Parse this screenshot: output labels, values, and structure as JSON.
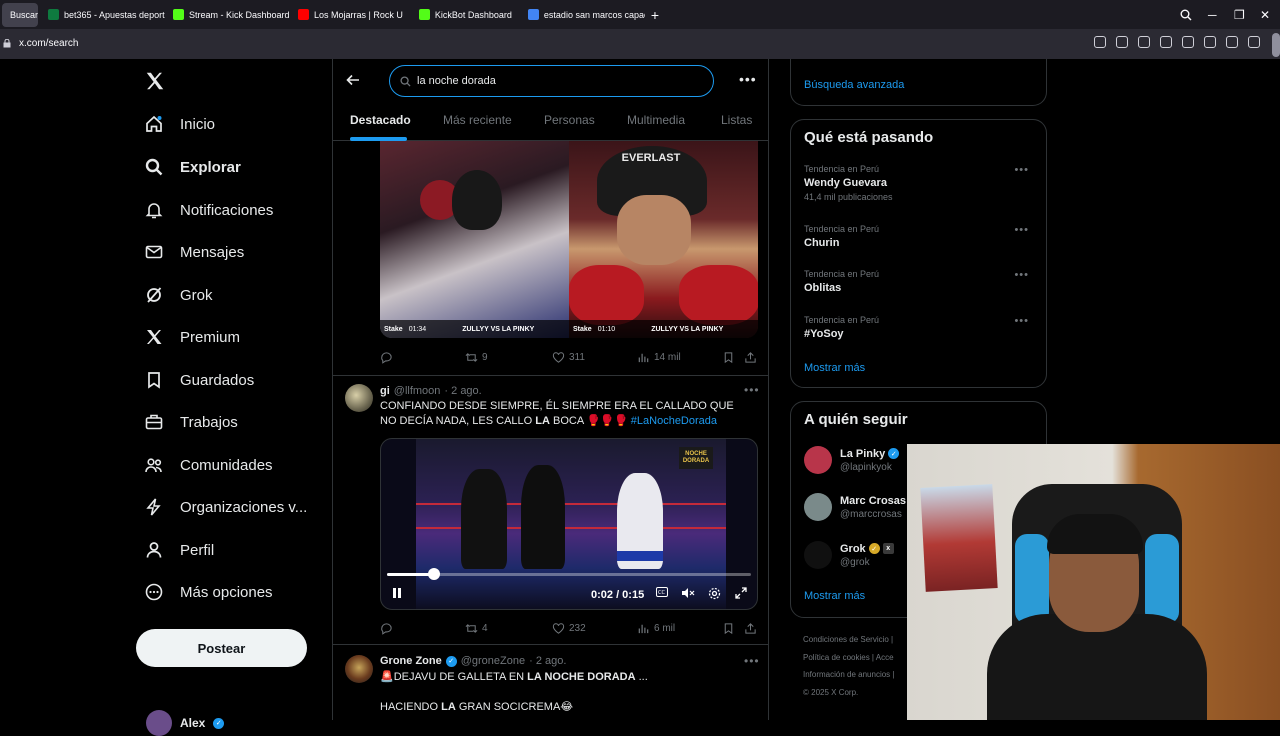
{
  "browser": {
    "tabs": [
      {
        "label": "Buscar",
        "active": true,
        "color": "#1d9bf0"
      },
      {
        "label": "bet365 - Apuestas deport",
        "active": false,
        "color": "#0e7a3f"
      },
      {
        "label": "Stream - Kick Dashboard",
        "active": false,
        "color": "#53fc18"
      },
      {
        "label": "Los Mojarras | Rock U",
        "active": false,
        "color": "#ff0000"
      },
      {
        "label": "KickBot Dashboard",
        "active": false,
        "color": "#53fc18"
      },
      {
        "label": "estadio san marcos capac",
        "active": false,
        "color": "#4285f4"
      }
    ],
    "url": "x.com/search"
  },
  "nav": {
    "items": [
      {
        "label": "Inicio",
        "icon": "home-icon"
      },
      {
        "label": "Explorar",
        "icon": "search-icon"
      },
      {
        "label": "Notificaciones",
        "icon": "bell-icon"
      },
      {
        "label": "Mensajes",
        "icon": "mail-icon"
      },
      {
        "label": "Grok",
        "icon": "grok-icon"
      },
      {
        "label": "Premium",
        "icon": "x-logo-icon"
      },
      {
        "label": "Guardados",
        "icon": "bookmark-icon"
      },
      {
        "label": "Trabajos",
        "icon": "briefcase-icon"
      },
      {
        "label": "Comunidades",
        "icon": "people-icon"
      },
      {
        "label": "Organizaciones v...",
        "icon": "lightning-icon"
      },
      {
        "label": "Perfil",
        "icon": "person-icon"
      },
      {
        "label": "Más opciones",
        "icon": "more-circle-icon"
      }
    ],
    "post_label": "Postear",
    "user_name": "Alex"
  },
  "search": {
    "query": "la noche dorada",
    "tabs": [
      "Destacado",
      "Más reciente",
      "Personas",
      "Multimedia",
      "Listas"
    ]
  },
  "tweet1": {
    "replies": "",
    "retweets": "9",
    "likes": "311",
    "views": "14 mil",
    "media_left_caption": "ZULLYY VS LA PINKY",
    "media_right_caption": "ZULLYY VS LA PINKY",
    "media_left_time": "01:34",
    "media_right_time": "01:10",
    "brand": "Stake",
    "brand_right": "EVERLAST"
  },
  "tweet2": {
    "name": "gi",
    "handle": "@llfmoon",
    "date": "· 2 ago.",
    "text_a": "CONFIANDO DESDE SIEMPRE, ÉL SIEMPRE ERA EL CALLADO QUE NO DECÍA NADA, LES CALLO ",
    "text_bold": "LA",
    "text_b": " BOCA 🥊🥊🥊 ",
    "hashtag": "#LaNocheDorada",
    "video_time": "0:02 / 0:15",
    "video_progress": 0.13,
    "video_logo": "NOCHE DORADA",
    "retweets": "4",
    "likes": "232",
    "views": "6 mil"
  },
  "tweet3": {
    "name": "Grone Zone",
    "handle": "@groneZone",
    "date": "· 2 ago.",
    "line1_a": "🚨DEJAVU DE GALLETA EN ",
    "line1_bold": "LA NOCHE DORADA",
    "line1_b": " ...",
    "line2_a": "HACIENDO ",
    "line2_bold": "LA",
    "line2_b": " GRAN SOCICREMA😂"
  },
  "sidebar": {
    "advanced_search": "Búsqueda avanzada",
    "trends_title": "Qué está pasando",
    "trends": [
      {
        "context": "Tendencia en Perú",
        "title": "Wendy Guevara",
        "count": "41,4 mil publicaciones"
      },
      {
        "context": "Tendencia en Perú",
        "title": "Churin",
        "count": ""
      },
      {
        "context": "Tendencia en Perú",
        "title": "Oblitas",
        "count": ""
      },
      {
        "context": "Tendencia en Perú",
        "title": "#YoSoy",
        "count": ""
      }
    ],
    "show_more": "Mostrar más",
    "follow_title": "A quién seguir",
    "follow": [
      {
        "name": "La Pinky",
        "handle": "@lapinkyok",
        "color": "#b8354a"
      },
      {
        "name": "Marc Crosas",
        "handle": "@marccrosas",
        "color": "#7a8a8a"
      },
      {
        "name": "Grok",
        "handle": "@grok",
        "color": "#101010"
      }
    ],
    "follow_show_more": "Mostrar más",
    "footer_lines": [
      "Condiciones de Servicio  |",
      "Política de cookies  |  Acce",
      "Información de anuncios  |",
      "© 2025 X Corp."
    ]
  },
  "colors": {
    "accent": "#1d9bf0",
    "background": "#000000",
    "border": "#2f3336",
    "muted": "#71767b"
  }
}
